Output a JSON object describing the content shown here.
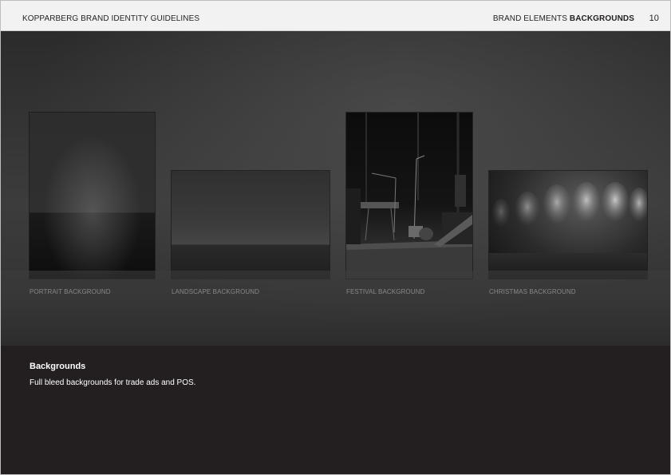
{
  "header": {
    "title": "KOPPARBERG BRAND IDENTITY GUIDELINES",
    "section_prefix": "BRAND ELEMENTS",
    "section_name": "BACKGROUNDS",
    "page_number": "10"
  },
  "backgrounds": [
    {
      "label": "PORTRAIT BACKGROUND"
    },
    {
      "label": "LANDSCAPE BACKGROUND"
    },
    {
      "label": "FESTIVAL BACKGROUND"
    },
    {
      "label": "CHRISTMAS BACKGROUND"
    }
  ],
  "info": {
    "heading": "Backgrounds",
    "text": "Full bleed backgrounds for trade ads and POS."
  },
  "colors": {
    "header_bg": "#f2f2f2",
    "panel_bg": "#231f20",
    "stage_bg": "#3a3a3a"
  }
}
